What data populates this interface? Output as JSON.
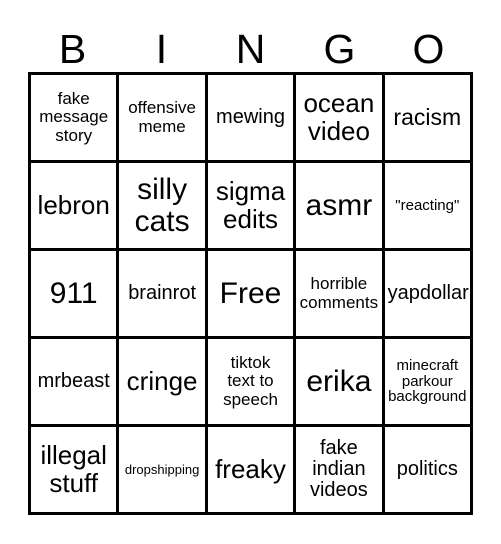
{
  "card": {
    "type": "bingo-card",
    "columns": 5,
    "rows": 5,
    "background_color": "#ffffff",
    "border_color": "#000000",
    "text_color": "#000000"
  },
  "header": {
    "letters": [
      {
        "label": "B"
      },
      {
        "label": "I"
      },
      {
        "label": "N"
      },
      {
        "label": "G"
      },
      {
        "label": "O"
      }
    ]
  },
  "grid": {
    "cells": [
      {
        "text": "fake\nmessage\nstory",
        "size": "fs-s",
        "free": false
      },
      {
        "text": "offensive\nmeme",
        "size": "fs-s",
        "free": false
      },
      {
        "text": "mewing",
        "size": "fs-m",
        "free": false
      },
      {
        "text": "ocean\nvideo",
        "size": "fs-xl",
        "free": false
      },
      {
        "text": "racism",
        "size": "fs-l",
        "free": false
      },
      {
        "text": "lebron",
        "size": "fs-xl",
        "free": false
      },
      {
        "text": "silly\ncats",
        "size": "fs-xxl",
        "free": false
      },
      {
        "text": "sigma\nedits",
        "size": "fs-xl",
        "free": false
      },
      {
        "text": "asmr",
        "size": "fs-xxl",
        "free": false
      },
      {
        "text": "\"reacting\"",
        "size": "fs-xs",
        "free": false
      },
      {
        "text": "911",
        "size": "fs-xxl",
        "free": false
      },
      {
        "text": "brainrot",
        "size": "fs-m",
        "free": false
      },
      {
        "text": "Free",
        "size": "fs-xxl",
        "free": true
      },
      {
        "text": "horrible\ncomments",
        "size": "fs-s",
        "free": false
      },
      {
        "text": "yapdollar",
        "size": "fs-m",
        "free": false
      },
      {
        "text": "mrbeast",
        "size": "fs-m",
        "free": false
      },
      {
        "text": "cringe",
        "size": "fs-xl",
        "free": false
      },
      {
        "text": "tiktok\ntext to\nspeech",
        "size": "fs-s",
        "free": false
      },
      {
        "text": "erika",
        "size": "fs-xxl",
        "free": false
      },
      {
        "text": "minecraft\nparkour\nbackground",
        "size": "fs-xs",
        "free": false
      },
      {
        "text": "illegal\nstuff",
        "size": "fs-xl",
        "free": false
      },
      {
        "text": "dropshipping",
        "size": "fs-xxs",
        "free": false
      },
      {
        "text": "freaky",
        "size": "fs-xl",
        "free": false
      },
      {
        "text": "fake\nindian\nvideos",
        "size": "fs-m",
        "free": false
      },
      {
        "text": "politics",
        "size": "fs-m",
        "free": false
      }
    ]
  }
}
